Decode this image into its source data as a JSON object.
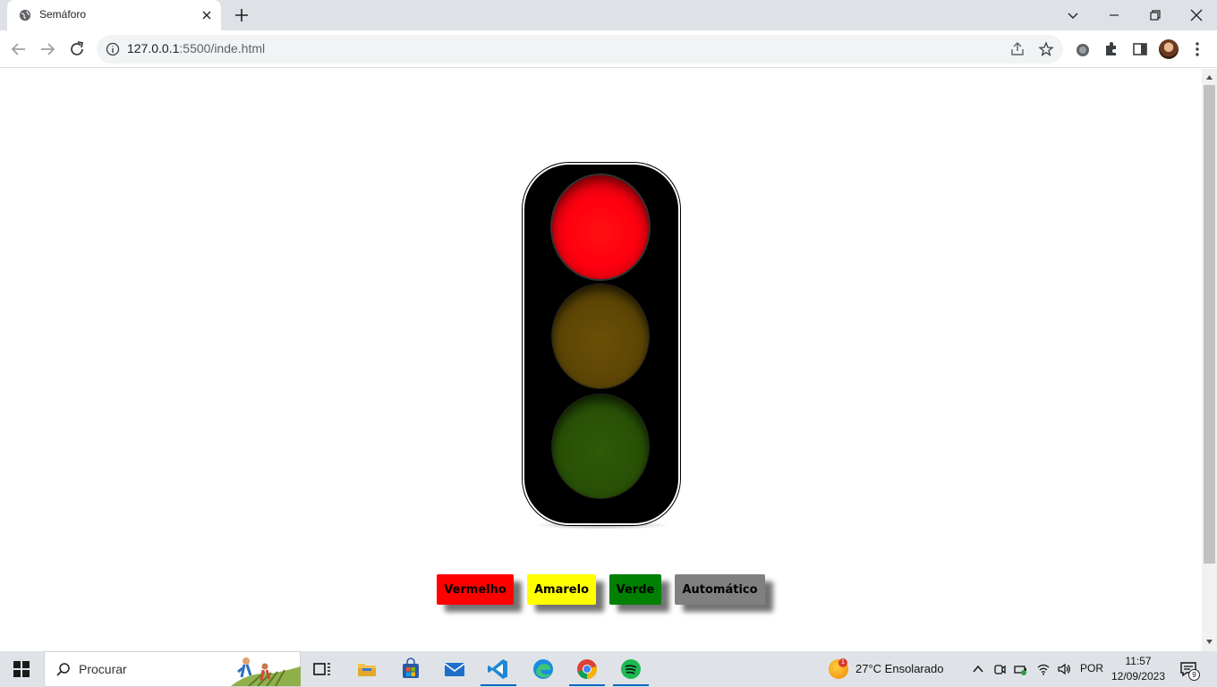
{
  "browser": {
    "tab": {
      "title": "Semáforo",
      "favicon": "globe-icon"
    },
    "url": {
      "host": "127.0.0.1",
      "path": ":5500/inde.html"
    },
    "icons": [
      "back-arrow-icon",
      "forward-arrow-icon",
      "reload-icon",
      "info-icon",
      "share-icon",
      "star-icon",
      "extension-icon",
      "puzzle-icon",
      "side-panel-icon",
      "avatar",
      "kebab-menu-icon"
    ]
  },
  "traffic_light": {
    "lamps": [
      {
        "color": "red",
        "state": "on",
        "hex": "#ff0010"
      },
      {
        "color": "yellow",
        "state": "off",
        "hex": "#5c4505"
      },
      {
        "color": "green",
        "state": "off",
        "hex": "#285006"
      }
    ]
  },
  "controls": {
    "red_label": "Vermelho",
    "yellow_label": "Amarelo",
    "green_label": "Verde",
    "auto_label": "Automático",
    "colors": {
      "red": "#ff0000",
      "yellow": "#ffff00",
      "green": "#008000",
      "auto": "#808080"
    }
  },
  "taskbar": {
    "search_placeholder": "Procurar",
    "weather": {
      "temp": "27°C",
      "condition": "Ensolarado",
      "badge": "1"
    },
    "language": "POR",
    "time": "11:57",
    "date": "12/09/2023",
    "notifications": "9"
  }
}
